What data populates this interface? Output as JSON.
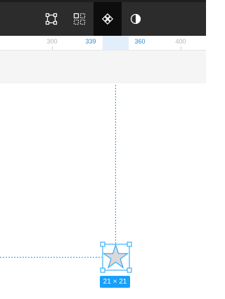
{
  "toolbar": {
    "tools": [
      {
        "name": "edit-object-tool",
        "icon": "vector-frame-icon",
        "active": false
      },
      {
        "name": "layout-grid-tool",
        "icon": "grid-layout-icon",
        "active": false
      },
      {
        "name": "component-tool",
        "icon": "component-icon",
        "active": true
      },
      {
        "name": "mask-tool",
        "icon": "half-circle-icon",
        "active": false
      }
    ]
  },
  "ruler": {
    "labels": [
      {
        "text": "300",
        "selected": false
      },
      {
        "text": "339",
        "selected": true
      },
      {
        "text": "360",
        "selected": true
      },
      {
        "text": "400",
        "selected": false
      }
    ]
  },
  "selection": {
    "size_label": "21 × 21",
    "shape": "star-icon"
  },
  "colors": {
    "toolbar_bg": "#2c2c2c",
    "active_tool_bg": "#0d0d0d",
    "accent": "#18a0fb",
    "ruler_selected_text": "#2a8ad8",
    "ruler_highlight": "#e3eefb",
    "star_fill": "#d9d9d9"
  }
}
